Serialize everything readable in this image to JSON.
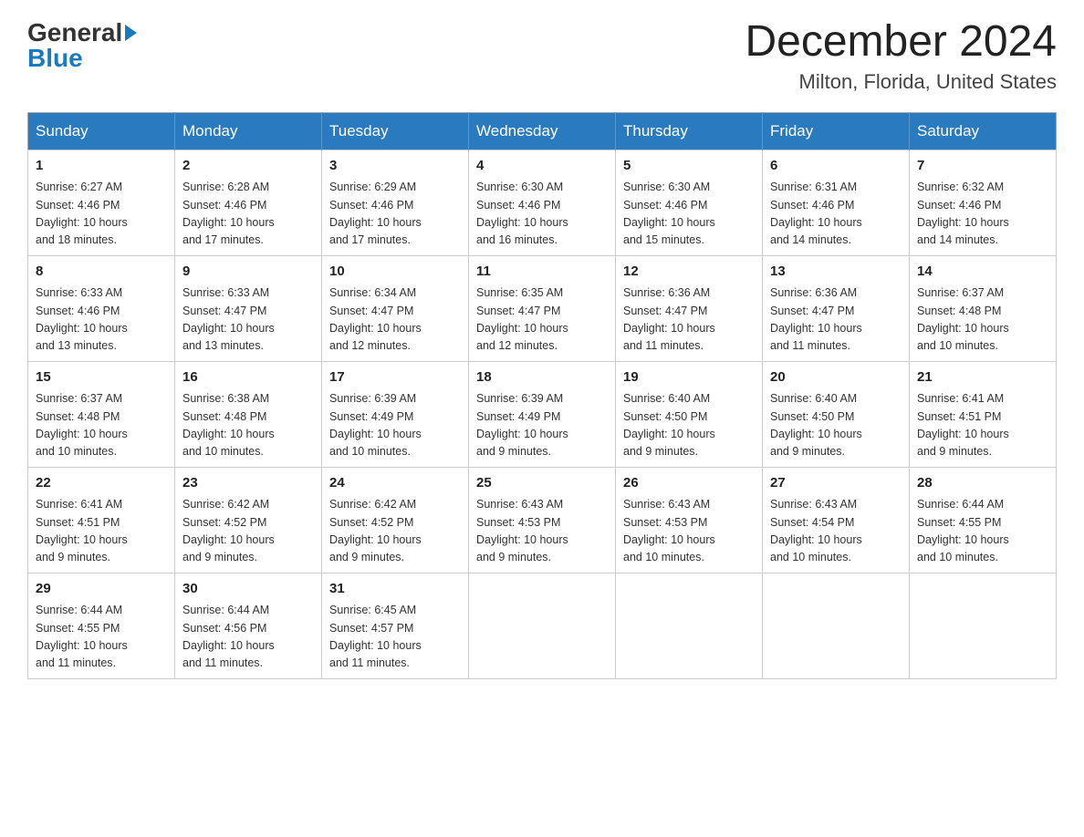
{
  "header": {
    "logo_text_general": "General",
    "logo_text_blue": "Blue",
    "month_title": "December 2024",
    "location": "Milton, Florida, United States"
  },
  "days_of_week": [
    "Sunday",
    "Monday",
    "Tuesday",
    "Wednesday",
    "Thursday",
    "Friday",
    "Saturday"
  ],
  "weeks": [
    [
      {
        "day": "1",
        "sunrise": "6:27 AM",
        "sunset": "4:46 PM",
        "daylight": "10 hours and 18 minutes."
      },
      {
        "day": "2",
        "sunrise": "6:28 AM",
        "sunset": "4:46 PM",
        "daylight": "10 hours and 17 minutes."
      },
      {
        "day": "3",
        "sunrise": "6:29 AM",
        "sunset": "4:46 PM",
        "daylight": "10 hours and 17 minutes."
      },
      {
        "day": "4",
        "sunrise": "6:30 AM",
        "sunset": "4:46 PM",
        "daylight": "10 hours and 16 minutes."
      },
      {
        "day": "5",
        "sunrise": "6:30 AM",
        "sunset": "4:46 PM",
        "daylight": "10 hours and 15 minutes."
      },
      {
        "day": "6",
        "sunrise": "6:31 AM",
        "sunset": "4:46 PM",
        "daylight": "10 hours and 14 minutes."
      },
      {
        "day": "7",
        "sunrise": "6:32 AM",
        "sunset": "4:46 PM",
        "daylight": "10 hours and 14 minutes."
      }
    ],
    [
      {
        "day": "8",
        "sunrise": "6:33 AM",
        "sunset": "4:46 PM",
        "daylight": "10 hours and 13 minutes."
      },
      {
        "day": "9",
        "sunrise": "6:33 AM",
        "sunset": "4:47 PM",
        "daylight": "10 hours and 13 minutes."
      },
      {
        "day": "10",
        "sunrise": "6:34 AM",
        "sunset": "4:47 PM",
        "daylight": "10 hours and 12 minutes."
      },
      {
        "day": "11",
        "sunrise": "6:35 AM",
        "sunset": "4:47 PM",
        "daylight": "10 hours and 12 minutes."
      },
      {
        "day": "12",
        "sunrise": "6:36 AM",
        "sunset": "4:47 PM",
        "daylight": "10 hours and 11 minutes."
      },
      {
        "day": "13",
        "sunrise": "6:36 AM",
        "sunset": "4:47 PM",
        "daylight": "10 hours and 11 minutes."
      },
      {
        "day": "14",
        "sunrise": "6:37 AM",
        "sunset": "4:48 PM",
        "daylight": "10 hours and 10 minutes."
      }
    ],
    [
      {
        "day": "15",
        "sunrise": "6:37 AM",
        "sunset": "4:48 PM",
        "daylight": "10 hours and 10 minutes."
      },
      {
        "day": "16",
        "sunrise": "6:38 AM",
        "sunset": "4:48 PM",
        "daylight": "10 hours and 10 minutes."
      },
      {
        "day": "17",
        "sunrise": "6:39 AM",
        "sunset": "4:49 PM",
        "daylight": "10 hours and 10 minutes."
      },
      {
        "day": "18",
        "sunrise": "6:39 AM",
        "sunset": "4:49 PM",
        "daylight": "10 hours and 9 minutes."
      },
      {
        "day": "19",
        "sunrise": "6:40 AM",
        "sunset": "4:50 PM",
        "daylight": "10 hours and 9 minutes."
      },
      {
        "day": "20",
        "sunrise": "6:40 AM",
        "sunset": "4:50 PM",
        "daylight": "10 hours and 9 minutes."
      },
      {
        "day": "21",
        "sunrise": "6:41 AM",
        "sunset": "4:51 PM",
        "daylight": "10 hours and 9 minutes."
      }
    ],
    [
      {
        "day": "22",
        "sunrise": "6:41 AM",
        "sunset": "4:51 PM",
        "daylight": "10 hours and 9 minutes."
      },
      {
        "day": "23",
        "sunrise": "6:42 AM",
        "sunset": "4:52 PM",
        "daylight": "10 hours and 9 minutes."
      },
      {
        "day": "24",
        "sunrise": "6:42 AM",
        "sunset": "4:52 PM",
        "daylight": "10 hours and 9 minutes."
      },
      {
        "day": "25",
        "sunrise": "6:43 AM",
        "sunset": "4:53 PM",
        "daylight": "10 hours and 9 minutes."
      },
      {
        "day": "26",
        "sunrise": "6:43 AM",
        "sunset": "4:53 PM",
        "daylight": "10 hours and 10 minutes."
      },
      {
        "day": "27",
        "sunrise": "6:43 AM",
        "sunset": "4:54 PM",
        "daylight": "10 hours and 10 minutes."
      },
      {
        "day": "28",
        "sunrise": "6:44 AM",
        "sunset": "4:55 PM",
        "daylight": "10 hours and 10 minutes."
      }
    ],
    [
      {
        "day": "29",
        "sunrise": "6:44 AM",
        "sunset": "4:55 PM",
        "daylight": "10 hours and 11 minutes."
      },
      {
        "day": "30",
        "sunrise": "6:44 AM",
        "sunset": "4:56 PM",
        "daylight": "10 hours and 11 minutes."
      },
      {
        "day": "31",
        "sunrise": "6:45 AM",
        "sunset": "4:57 PM",
        "daylight": "10 hours and 11 minutes."
      },
      null,
      null,
      null,
      null
    ]
  ],
  "labels": {
    "sunrise": "Sunrise:",
    "sunset": "Sunset:",
    "daylight": "Daylight:"
  }
}
